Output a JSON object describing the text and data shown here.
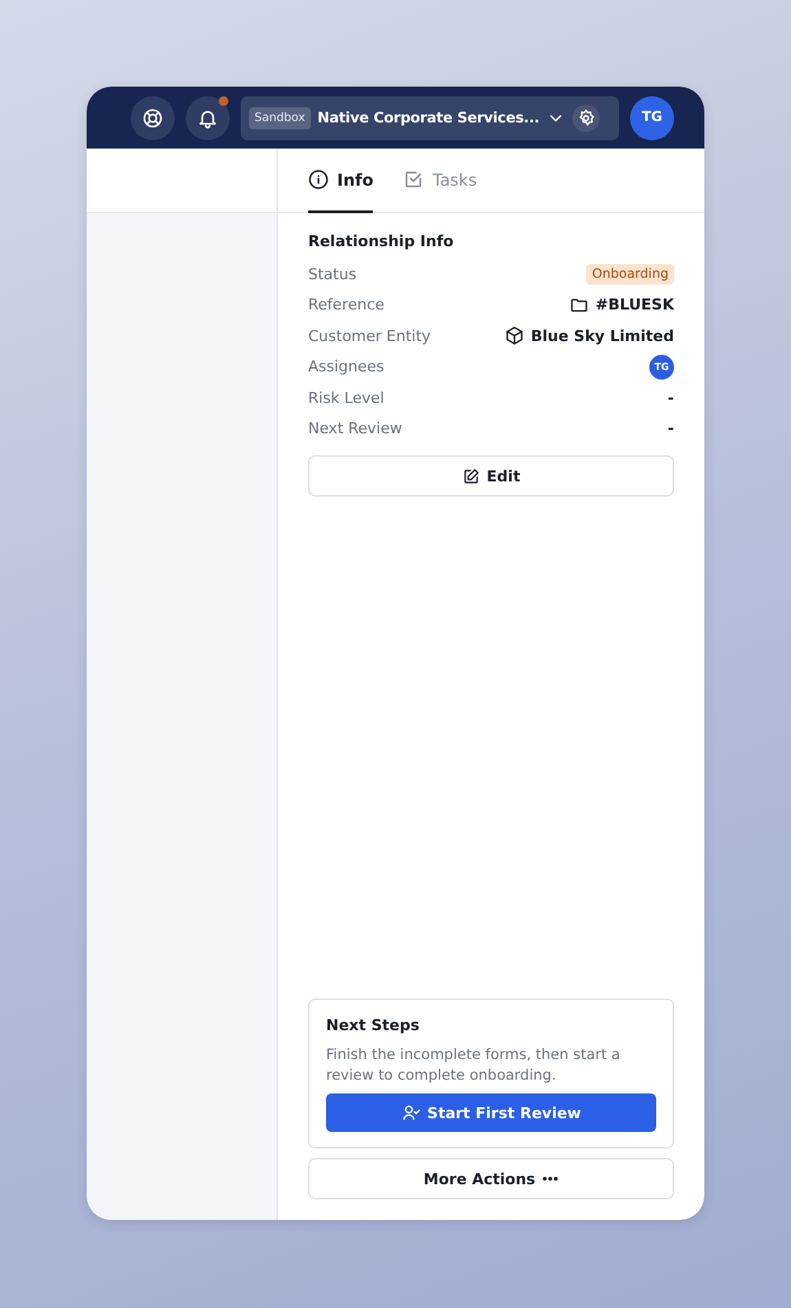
{
  "header": {
    "environment_badge": "Sandbox",
    "workspace": "Native Corporate Services...",
    "notifications_unread": true,
    "user_initials": "TG"
  },
  "tabs": [
    {
      "label": "Info",
      "kind": "info",
      "selected": true
    },
    {
      "label": "Tasks",
      "kind": "tasks",
      "selected": false
    }
  ],
  "relationship_info": {
    "title": "Relationship Info",
    "fields": [
      {
        "label": "Status",
        "kind": "badge",
        "value": "Onboarding"
      },
      {
        "label": "Reference",
        "kind": "folder",
        "value": "#BLUESK"
      },
      {
        "label": "Customer Entity",
        "kind": "entity",
        "value": "Blue Sky Limited"
      },
      {
        "label": "Assignees",
        "kind": "avatar",
        "value": "TG"
      },
      {
        "label": "Risk Level",
        "kind": "text",
        "value": "-"
      },
      {
        "label": "Next Review",
        "kind": "text",
        "value": "-"
      }
    ],
    "edit_button": "Edit"
  },
  "next_steps": {
    "title": "Next Steps",
    "description": "Finish the incomplete forms, then start a review to complete onboarding.",
    "primary_button": "Start First Review"
  },
  "more_actions_button": "More Actions"
}
